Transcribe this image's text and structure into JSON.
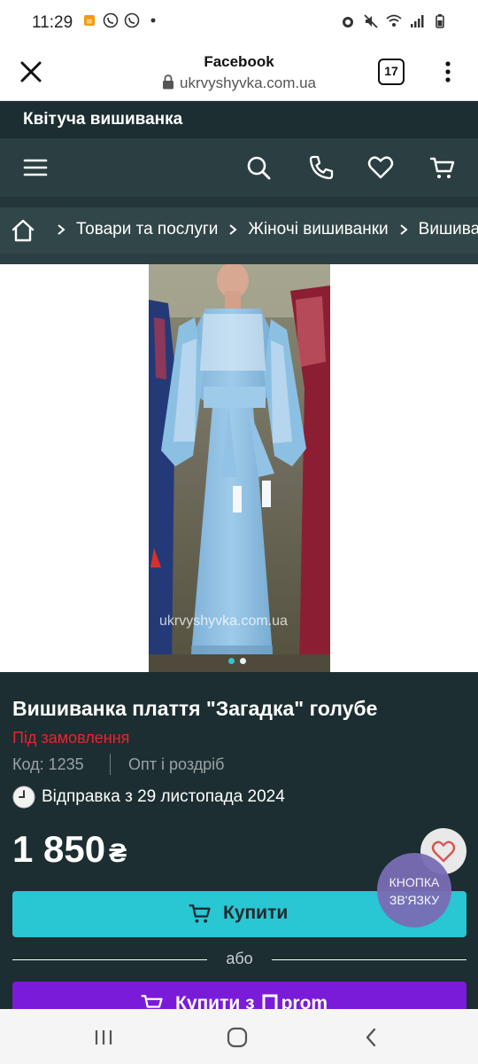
{
  "status_bar": {
    "time": "11:29",
    "left_icons": [
      "lowbattery-notification-icon",
      "viber-icon",
      "viber-icon",
      "dot-icon"
    ],
    "right_icons": [
      "alarm-icon",
      "mute-icon",
      "wifi-icon",
      "signal-icon",
      "battery-icon"
    ]
  },
  "browser": {
    "title": "Facebook",
    "url": "ukrvyshyvka.com.ua",
    "tab_count": "17"
  },
  "site": {
    "brand": "Квітуча вишиванка",
    "nav_icons": [
      "menu-icon",
      "search-icon",
      "phone-icon",
      "heart-icon",
      "cart-icon"
    ]
  },
  "breadcrumb": {
    "items": [
      "Товари та послуги",
      "Жіночі вишиванки",
      "Вишиванки плаття"
    ]
  },
  "gallery": {
    "watermark": "ukrvyshyvka.com.ua",
    "total_images": 2,
    "active_index": 0
  },
  "product": {
    "title": "Вишиванка плаття \"Загадка\" голубе",
    "availability": "Під замовлення",
    "code": "Код: 1235",
    "sale_type": "Опт і роздріб",
    "shipping": "Відправка з 29 листопада 2024",
    "price": "1 850",
    "currency": "₴",
    "buy_label": "Купити",
    "or_label": "або",
    "prom_label": "Купити з",
    "prom_brand": "prom",
    "contact_label_1": "КНОПКА",
    "contact_label_2": "ЗВ'ЯЗКУ"
  },
  "colors": {
    "header_dark": "#1c2e31",
    "nav_bg": "#2b3f43",
    "accent_cyan": "#29c6d4",
    "prom_purple": "#7a1bd9",
    "status_red": "#e5262d"
  }
}
